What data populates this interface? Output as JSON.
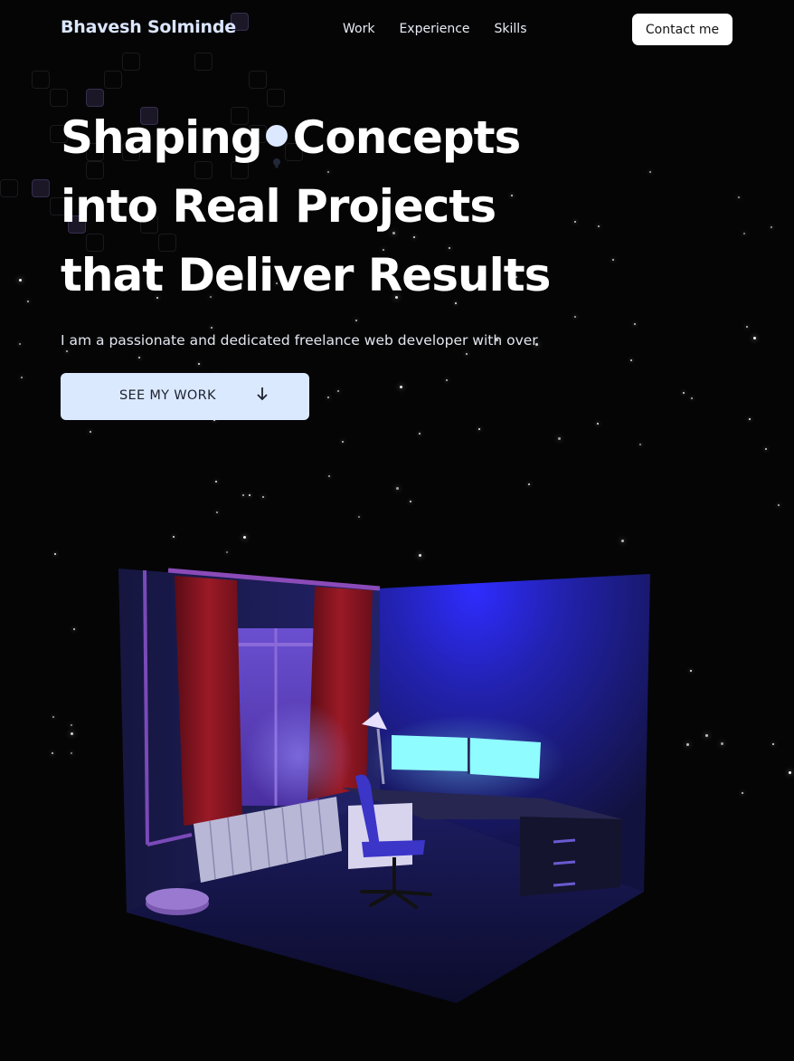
{
  "nav": {
    "brand": "Bhavesh Solminde",
    "links": [
      "Work",
      "Experience",
      "Skills"
    ],
    "contact_label": "Contact me"
  },
  "hero": {
    "line1_part1": "Shaping",
    "line1_part2": "Concepts",
    "line2": "into Real Projects",
    "line3": "that Deliver Results",
    "inline_icon": "lightbulb-icon",
    "subtitle": "I am a passionate and dedicated freelance web developer with over",
    "cta_label": "SEE MY WORK",
    "cta_icon": "arrow-down-icon"
  },
  "scene": {
    "description_icon": "3d-room-illustration"
  },
  "colors": {
    "background": "#050506",
    "brand_text": "#dbe6ff",
    "cta_bg": "#dbe9ff",
    "monitor_glow": "#8ffcff",
    "curtain": "#8c1520",
    "room_blue": "#2a2a9a"
  }
}
